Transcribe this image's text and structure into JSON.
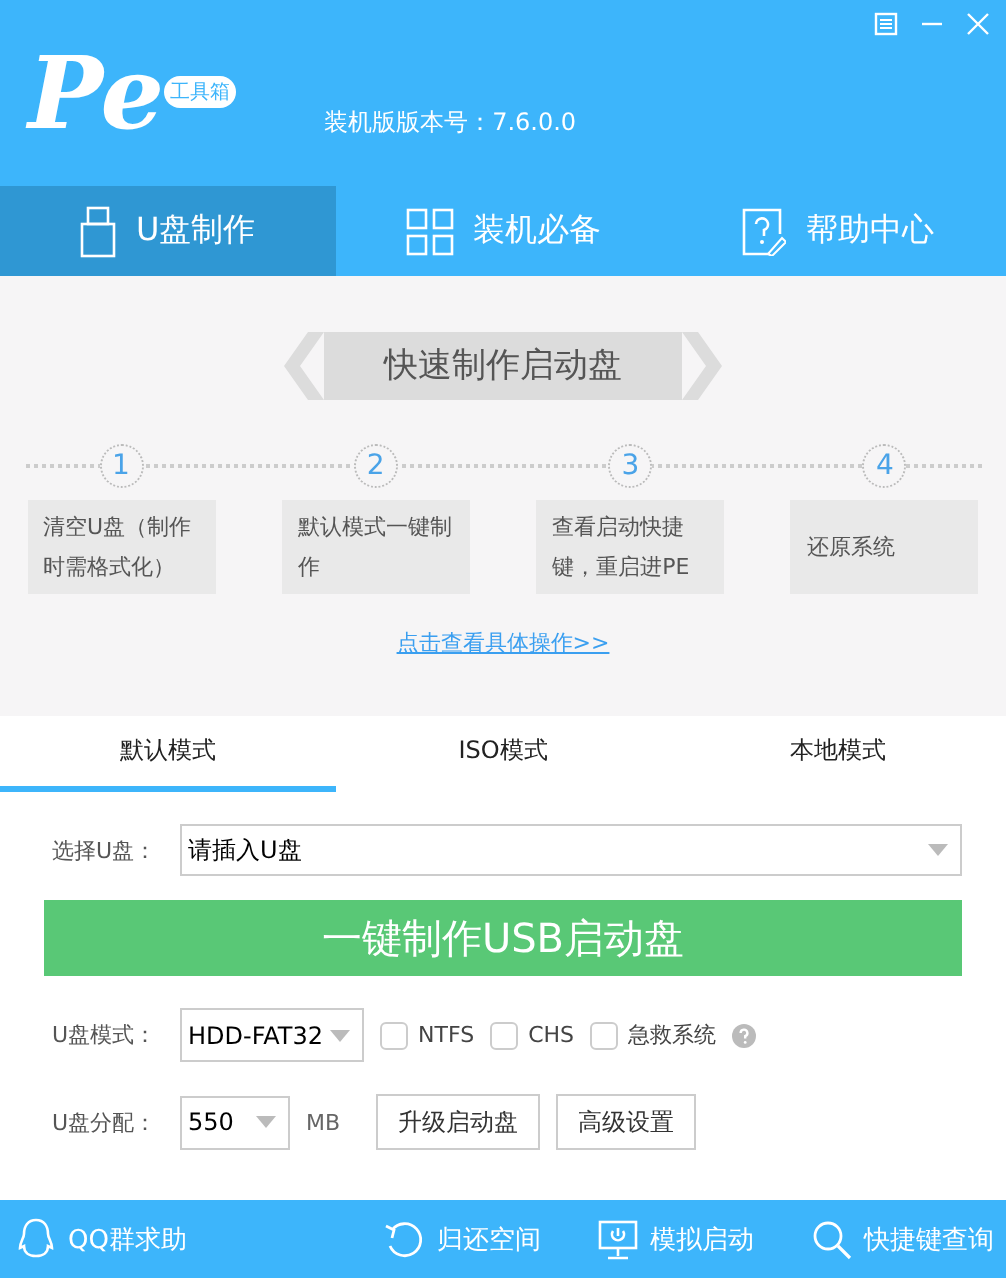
{
  "header": {
    "logo_text": "Pe",
    "logo_badge": "工具箱",
    "version": "装机版版本号：7.6.0.0"
  },
  "nav_tabs": [
    {
      "label": "U盘制作",
      "kind": "usb",
      "selected": true
    },
    {
      "label": "装机必备",
      "kind": "grid",
      "selected": false
    },
    {
      "label": "帮助中心",
      "kind": "help",
      "selected": false
    }
  ],
  "guide": {
    "title": "快速制作启动盘",
    "steps": [
      {
        "number": "1",
        "text": "清空U盘（制作时需格式化）"
      },
      {
        "number": "2",
        "text": "默认模式一键制作"
      },
      {
        "number": "3",
        "text": "查看启动快捷键，重启进PE"
      },
      {
        "number": "4",
        "text": "还原系统"
      }
    ],
    "link": "点击查看具体操作>>"
  },
  "mode_tabs": [
    {
      "label": "默认模式",
      "selected": true
    },
    {
      "label": "ISO模式",
      "selected": false
    },
    {
      "label": "本地模式",
      "selected": false
    }
  ],
  "form": {
    "select_label": "选择U盘：",
    "select_value": "请插入U盘",
    "make_button": "一键制作USB启动盘",
    "mode_label": "U盘模式：",
    "mode_value": "HDD-FAT32",
    "options": [
      {
        "label": "NTFS",
        "checked": false
      },
      {
        "label": "CHS",
        "checked": false
      },
      {
        "label": "急救系统",
        "checked": false
      }
    ],
    "size_label": "U盘分配：",
    "size_value": "550",
    "size_unit": "MB",
    "buttons": [
      "升级启动盘",
      "高级设置"
    ]
  },
  "footer": [
    {
      "label": "QQ群求助",
      "kind": "qq"
    },
    {
      "label": "归还空间",
      "kind": "restore"
    },
    {
      "label": "模拟启动",
      "kind": "monitor"
    },
    {
      "label": "快捷键查询",
      "kind": "search"
    }
  ]
}
